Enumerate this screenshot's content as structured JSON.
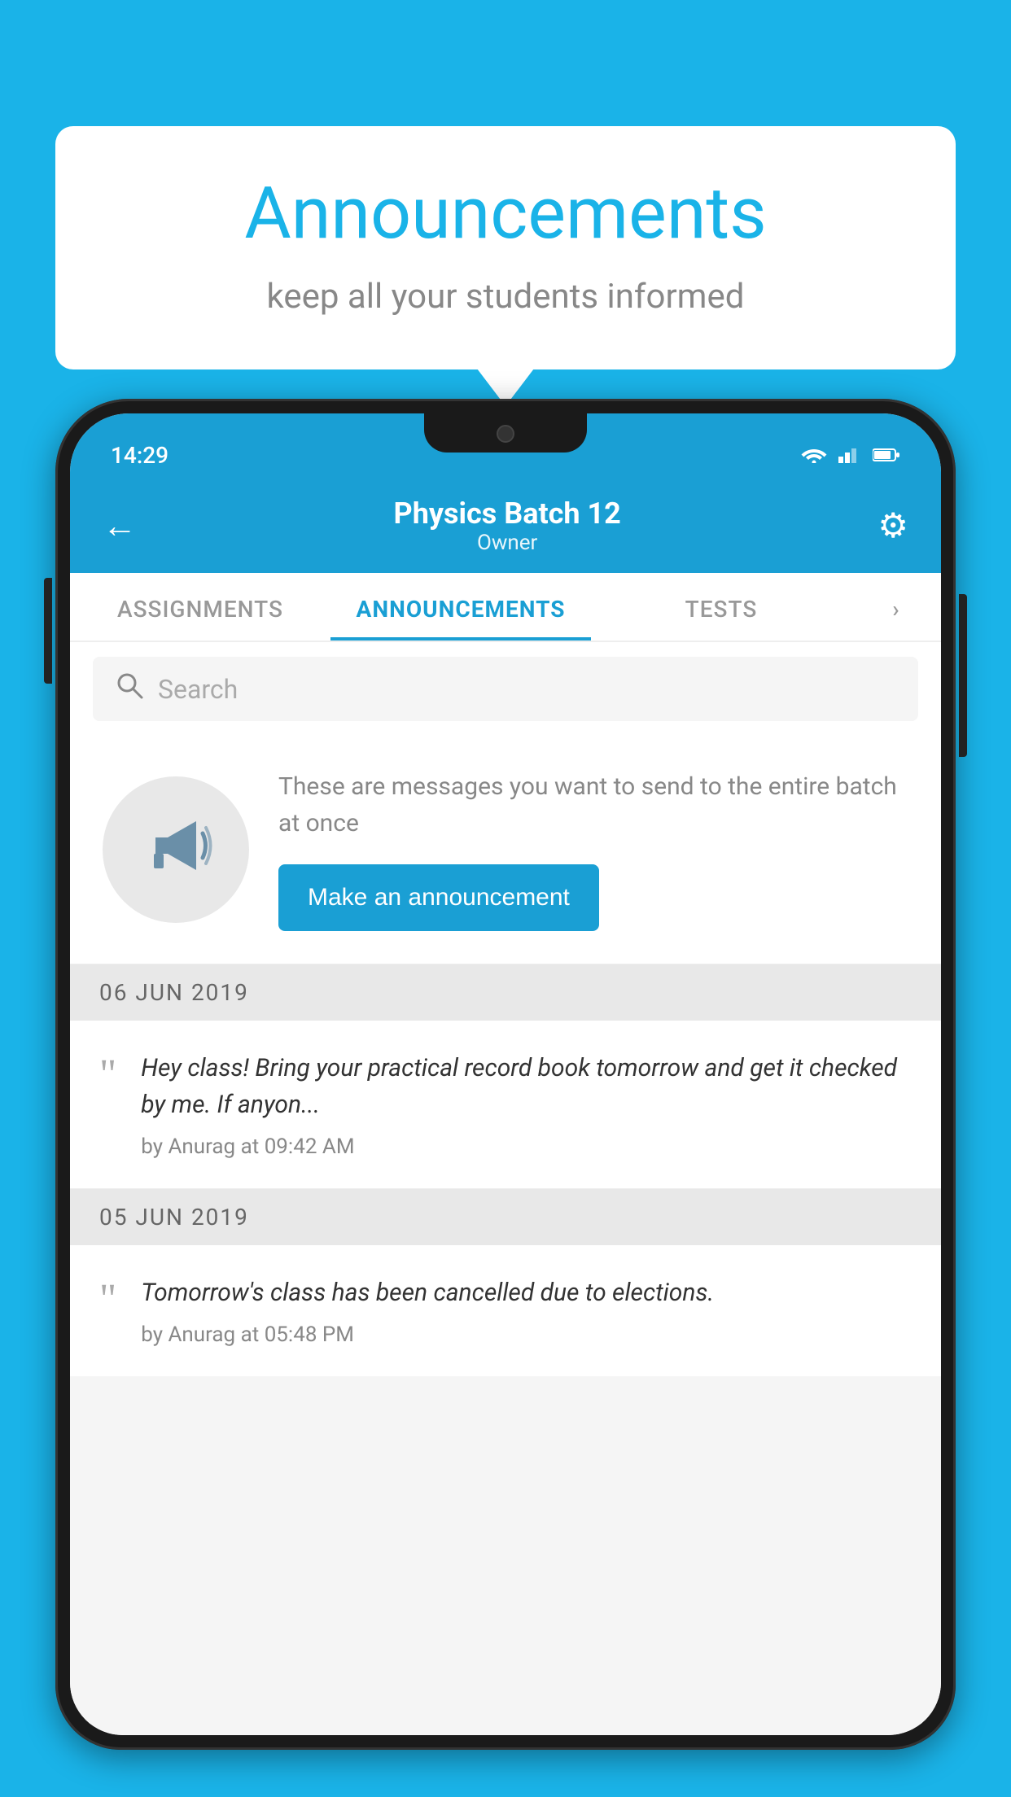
{
  "background_color": "#1ab3e8",
  "speech_bubble": {
    "title": "Announcements",
    "subtitle": "keep all your students informed"
  },
  "phone": {
    "status_bar": {
      "time": "14:29",
      "wifi": "▾",
      "signal": "▲",
      "battery": "▮"
    },
    "app_bar": {
      "back_icon": "←",
      "title": "Physics Batch 12",
      "subtitle": "Owner",
      "gear_icon": "⚙"
    },
    "tabs": [
      {
        "label": "ASSIGNMENTS",
        "active": false
      },
      {
        "label": "ANNOUNCEMENTS",
        "active": true
      },
      {
        "label": "TESTS",
        "active": false
      },
      {
        "label": "›",
        "active": false
      }
    ],
    "search": {
      "placeholder": "Search"
    },
    "promo": {
      "description": "These are messages you want to send to the entire batch at once",
      "button_label": "Make an announcement"
    },
    "announcements": [
      {
        "date": "06  JUN  2019",
        "message": "Hey class! Bring your practical record book tomorrow and get it checked by me. If anyon...",
        "author": "by Anurag at 09:42 AM"
      },
      {
        "date": "05  JUN  2019",
        "message": "Tomorrow's class has been cancelled due to elections.",
        "author": "by Anurag at 05:48 PM"
      }
    ]
  }
}
